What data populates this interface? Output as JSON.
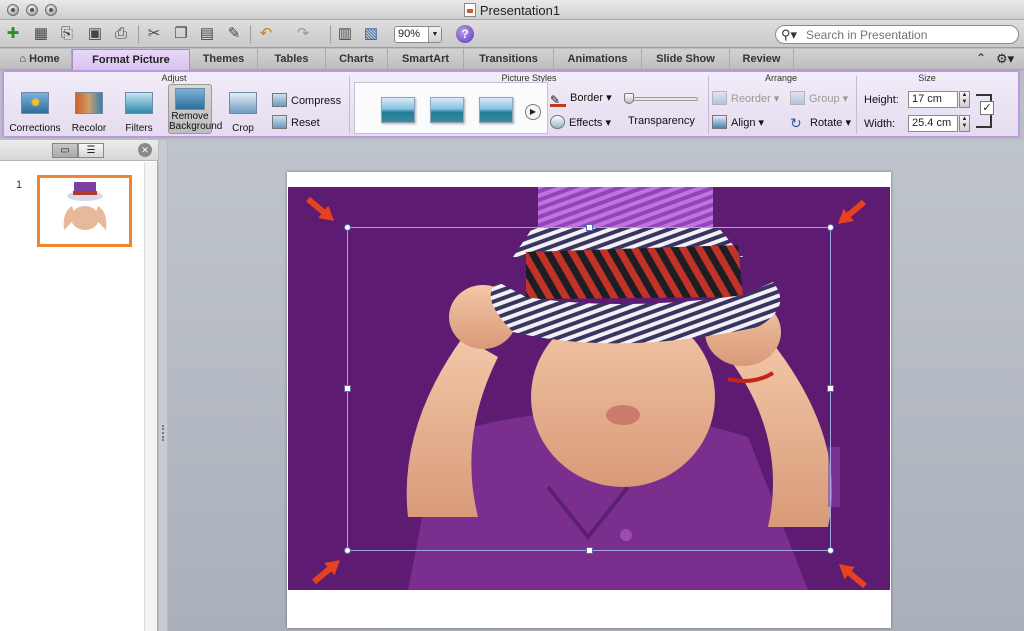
{
  "window": {
    "title": "Presentation1"
  },
  "toolbar": {
    "zoom": "90%",
    "search_placeholder": "Search in Presentation"
  },
  "tabs": [
    {
      "label": "Home"
    },
    {
      "label": "Format Picture"
    },
    {
      "label": "Themes"
    },
    {
      "label": "Tables"
    },
    {
      "label": "Charts"
    },
    {
      "label": "SmartArt"
    },
    {
      "label": "Transitions"
    },
    {
      "label": "Animations"
    },
    {
      "label": "Slide Show"
    },
    {
      "label": "Review"
    }
  ],
  "ribbon": {
    "adjust": {
      "title": "Adjust",
      "corrections": "Corrections",
      "recolor": "Recolor",
      "filters": "Filters",
      "remove_background_1": "Remove",
      "remove_background_2": "Background",
      "crop": "Crop",
      "compress": "Compress",
      "reset": "Reset"
    },
    "picture_styles": {
      "title": "Picture Styles",
      "border": "Border",
      "effects": "Effects",
      "transparency": "Transparency",
      "transparency_value": 0.0
    },
    "arrange": {
      "title": "Arrange",
      "reorder": "Reorder",
      "group": "Group",
      "align": "Align",
      "rotate": "Rotate"
    },
    "size": {
      "title": "Size",
      "height_label": "Height:",
      "height_value": "17 cm",
      "width_label": "Width:",
      "width_value": "25.4 cm"
    }
  },
  "slides_panel": {
    "slide_number": "1"
  },
  "colors": {
    "accent_tab": "#d9c2f0",
    "photo_background": "#5d1c72",
    "arrow": "#e8411f",
    "selected_slide_border": "#f0852d"
  }
}
